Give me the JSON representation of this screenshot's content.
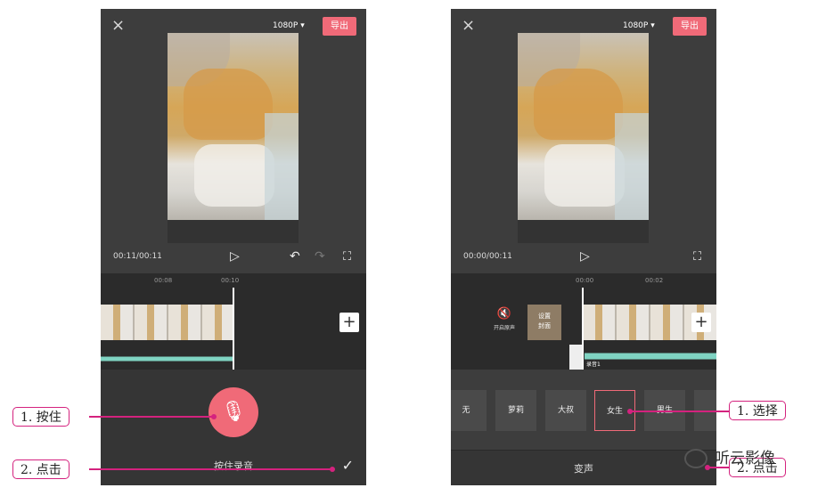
{
  "left": {
    "close_icon": "×",
    "resolution": "1080P ▾",
    "export_label": "导出",
    "time": "00:11/00:11",
    "ruler": [
      "00:08",
      "00:10"
    ],
    "hold_to_record": "按住录音",
    "mic_icon": "🎙",
    "check_icon": "✓"
  },
  "right": {
    "close_icon": "×",
    "resolution": "1080P ▾",
    "export_label": "导出",
    "time": "00:00/00:11",
    "ruler": [
      "00:00",
      "00:02"
    ],
    "mute_label": "开启原声",
    "cover_label": "设置\n封面",
    "recording_tag": "录音1",
    "voices": [
      "无",
      "萝莉",
      "大叔",
      "女生",
      "男生",
      "..."
    ],
    "selected_voice": "女生",
    "bottom_title": "变声"
  },
  "callouts": {
    "hold": "1. 按住",
    "tap": "2. 点击",
    "select": "1. 选择",
    "tap_right": "2. 点击"
  },
  "watermark": "听云影像",
  "colors": {
    "accent": "#f06a78",
    "callout": "#d4227e",
    "waveform": "#7fd3c2"
  }
}
